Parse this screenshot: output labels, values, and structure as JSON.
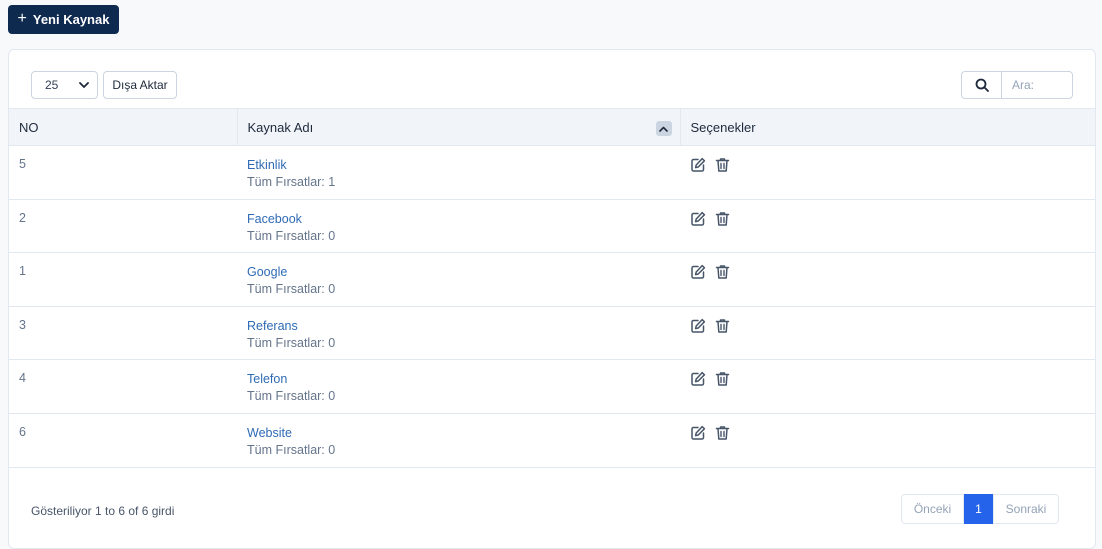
{
  "header": {
    "new_button_label": "Yeni Kaynak"
  },
  "toolbar": {
    "page_length_value": "25",
    "export_label": "Dışa Aktar",
    "search_placeholder": "Ara:"
  },
  "table": {
    "columns": [
      "NO",
      "Kaynak Adı",
      "Seçenekler"
    ],
    "rows": [
      {
        "no": "5",
        "name": "Etkinlik",
        "sub": "Tüm Fırsatlar: 1"
      },
      {
        "no": "2",
        "name": "Facebook",
        "sub": "Tüm Fırsatlar: 0"
      },
      {
        "no": "1",
        "name": "Google",
        "sub": "Tüm Fırsatlar: 0"
      },
      {
        "no": "3",
        "name": "Referans",
        "sub": "Tüm Fırsatlar: 0"
      },
      {
        "no": "4",
        "name": "Telefon",
        "sub": "Tüm Fırsatlar: 0"
      },
      {
        "no": "6",
        "name": "Website",
        "sub": "Tüm Fırsatlar: 0"
      }
    ]
  },
  "footer": {
    "info": "Gösteriliyor 1 to 6 of 6 girdi",
    "prev_label": "Önceki",
    "current_page": "1",
    "next_label": "Sonraki"
  },
  "icons": {
    "plus": "plus-icon",
    "search": "search-icon",
    "sort": "chevron-up-icon",
    "edit": "edit-icon",
    "delete": "trash-icon"
  },
  "colors": {
    "primary_dark": "#0f2a4f",
    "link": "#2f6bb5",
    "active_page": "#2563eb"
  }
}
